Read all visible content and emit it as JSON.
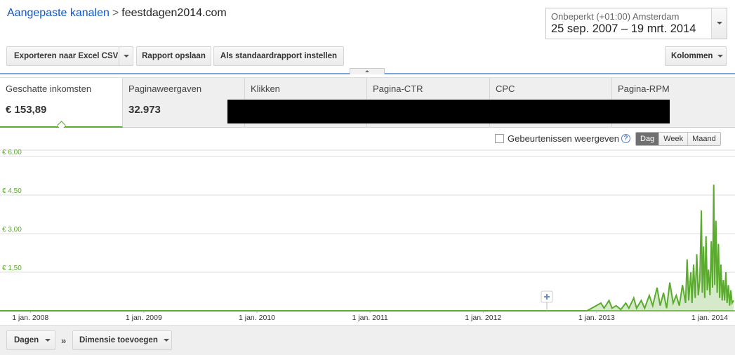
{
  "breadcrumb": {
    "parent": "Aangepaste kanalen",
    "separator": ">",
    "current": "feestdagen2014.com"
  },
  "date_range": {
    "timezone": "Onbeperkt (+01:00) Amsterdam",
    "range": "25 sep. 2007 – 19 mrt. 2014"
  },
  "toolbar": {
    "export_label": "Exporteren naar Excel CSV",
    "save_label": "Rapport opslaan",
    "default_label": "Als standaardrapport instellen",
    "columns_label": "Kolommen"
  },
  "metrics": [
    {
      "label": "Geschatte inkomsten",
      "value": "€ 153,89"
    },
    {
      "label": "Paginaweergaven",
      "value": "32.973"
    },
    {
      "label": "Klikken",
      "value": ""
    },
    {
      "label": "Pagina-CTR",
      "value": ""
    },
    {
      "label": "CPC",
      "value": ""
    },
    {
      "label": "Pagina-RPM",
      "value": ""
    }
  ],
  "events": {
    "label": "Gebeurtenissen weergeven",
    "checked": false,
    "help": "?"
  },
  "granularity": {
    "options": [
      "Dag",
      "Week",
      "Maand"
    ],
    "selected": "Dag"
  },
  "chart_data": {
    "type": "line",
    "series_color": "#5aab2e",
    "ylim": [
      0,
      6.0
    ],
    "yticks": [
      "€ 6,00",
      "€ 4,50",
      "€ 3,00",
      "€ 1,50"
    ],
    "yvalues": [
      6.0,
      4.5,
      3.0,
      1.5
    ],
    "xticks": [
      "1 jan. 2008",
      "1 jan. 2009",
      "1 jan. 2010",
      "1 jan. 2011",
      "1 jan. 2012",
      "1 jan. 2013",
      "1 jan. 2014"
    ],
    "x_start": "2007-09-25",
    "x_end": "2014-03-19",
    "series": [
      {
        "values": [
          [
            "2007-09-25",
            0
          ],
          [
            "2012-12-01",
            0
          ],
          [
            "2013-01-15",
            0.3
          ],
          [
            "2013-01-25",
            0.1
          ],
          [
            "2013-02-10",
            0.4
          ],
          [
            "2013-02-20",
            0.1
          ],
          [
            "2013-03-05",
            0.2
          ],
          [
            "2013-03-20",
            0.05
          ],
          [
            "2013-04-05",
            0.3
          ],
          [
            "2013-04-15",
            0.1
          ],
          [
            "2013-05-01",
            0.5
          ],
          [
            "2013-05-10",
            0.1
          ],
          [
            "2013-05-25",
            0.4
          ],
          [
            "2013-06-05",
            0.1
          ],
          [
            "2013-06-20",
            0.6
          ],
          [
            "2013-07-01",
            0.2
          ],
          [
            "2013-07-15",
            0.9
          ],
          [
            "2013-07-25",
            0.2
          ],
          [
            "2013-08-05",
            0.7
          ],
          [
            "2013-08-15",
            0.1
          ],
          [
            "2013-08-25",
            1.1
          ],
          [
            "2013-09-05",
            0.3
          ],
          [
            "2013-09-15",
            0.6
          ],
          [
            "2013-09-25",
            0.2
          ],
          [
            "2013-10-05",
            1.0
          ],
          [
            "2013-10-15",
            0.3
          ],
          [
            "2013-10-20",
            2.0
          ],
          [
            "2013-10-25",
            0.4
          ],
          [
            "2013-11-01",
            1.5
          ],
          [
            "2013-11-05",
            0.3
          ],
          [
            "2013-11-10",
            1.8
          ],
          [
            "2013-11-15",
            0.5
          ],
          [
            "2013-11-20",
            2.2
          ],
          [
            "2013-11-25",
            0.6
          ],
          [
            "2013-11-30",
            1.2
          ],
          [
            "2013-12-05",
            3.9
          ],
          [
            "2013-12-08",
            0.7
          ],
          [
            "2013-12-12",
            2.5
          ],
          [
            "2013-12-16",
            0.5
          ],
          [
            "2013-12-20",
            2.9
          ],
          [
            "2013-12-24",
            0.8
          ],
          [
            "2013-12-28",
            1.6
          ],
          [
            "2014-01-02",
            0.6
          ],
          [
            "2014-01-06",
            2.7
          ],
          [
            "2014-01-10",
            0.9
          ],
          [
            "2014-01-14",
            4.9
          ],
          [
            "2014-01-17",
            1.0
          ],
          [
            "2014-01-21",
            3.5
          ],
          [
            "2014-01-25",
            0.7
          ],
          [
            "2014-01-29",
            2.6
          ],
          [
            "2014-02-02",
            0.5
          ],
          [
            "2014-02-06",
            1.8
          ],
          [
            "2014-02-10",
            0.4
          ],
          [
            "2014-02-14",
            1.2
          ],
          [
            "2014-02-18",
            0.4
          ],
          [
            "2014-02-22",
            1.5
          ],
          [
            "2014-02-26",
            0.3
          ],
          [
            "2014-03-02",
            1.0
          ],
          [
            "2014-03-06",
            0.2
          ],
          [
            "2014-03-10",
            0.8
          ],
          [
            "2014-03-14",
            0.3
          ],
          [
            "2014-03-19",
            0.4
          ]
        ]
      }
    ]
  },
  "bottom": {
    "primary_dimension": "Dagen",
    "separator": "»",
    "add_dimension": "Dimensie toevoegen"
  }
}
